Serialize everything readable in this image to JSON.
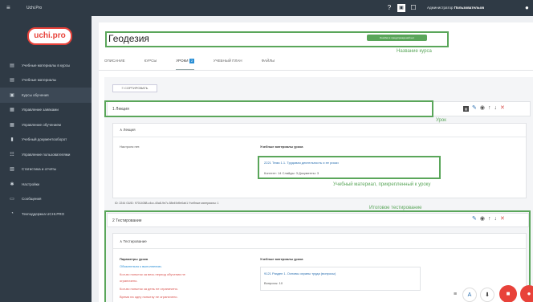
{
  "topbar": {
    "menu_icon": "≡",
    "brand": "Uchi.Pro",
    "help_icon": "?",
    "note_icon": "▣",
    "chat_icon": "☐",
    "user_prefix": "Администратор",
    "user_name": "Пользовательов",
    "user_icon": "●"
  },
  "sidebar": {
    "logo": "uchi.pro",
    "items": [
      {
        "icon": "▤",
        "label": "Учебные материалы в курсы"
      },
      {
        "icon": "▤",
        "label": "Учебные материалы"
      },
      {
        "icon": "▣",
        "label": "Курсы обучения"
      },
      {
        "icon": "▦",
        "label": "Управление заявками"
      },
      {
        "icon": "▦",
        "label": "Управление обучением"
      },
      {
        "icon": "▮",
        "label": "Учебный документооборот"
      },
      {
        "icon": "☷",
        "label": "Управление пользователями"
      },
      {
        "icon": "▧",
        "label": "Статистика и отчёты"
      },
      {
        "icon": "✱",
        "label": "Настройки"
      },
      {
        "icon": "▭",
        "label": "Сообщения"
      },
      {
        "icon": "◔",
        "label": "Техподдержка UCHI.PRO"
      }
    ]
  },
  "course": {
    "title": "Геодезия",
    "published_badge": "Ошибки в предупреждений нет",
    "course_name_note": "Название курса"
  },
  "tabs": [
    {
      "label": "ОПИСАНИЕ"
    },
    {
      "label": "КУРСЫ"
    },
    {
      "label": "УРОКИ",
      "count": "2"
    },
    {
      "label": "УЧЕБНЫЙ ПЛАН"
    },
    {
      "label": "ФАЙЛЫ"
    }
  ],
  "sort_button": "СОРТИРОВАТЬ",
  "lesson1": {
    "number": "1",
    "title": "Лекция",
    "note": "Урок",
    "sub_title": "Лекция",
    "settings": "Настроек нет.",
    "materials_heading": "Учебные материалы урока",
    "material_id": "2221",
    "material_title": "Тема 1.1. Трудовая деятельность и ее риски",
    "material_stats": "Контент: 14   Слайды: 3   Документы: 3",
    "material_note": "Учебный материал, прикрепленный к уроку",
    "footer": "ID: 2244   GUID: 97014088-c4cc-40a8-9e7c-58e49d9e0ab1   Учебные материалы: 1"
  },
  "lesson2": {
    "number": "2",
    "title": "Тестирование",
    "note": "Итоговое тестирование",
    "sub_title": "Тестирование",
    "params_heading": "Параметры урока",
    "param1": "Обязательно к выполнению.",
    "param2a": "Кол-во попыток за весь период обучения не",
    "param2b": "ограничено.",
    "param3": "Кол-во попыток за день не ограничено.",
    "param4": "Время на одну попытку не ограничено.",
    "materials_heading": "Учебные материалы урока",
    "material_id": "9121",
    "material_title": "Раздел 1. Основы охраны труда (вопросы)",
    "material_stats": "Вопросы: 10"
  },
  "actions": {
    "copy": "▤",
    "edit": "✎",
    "view": "◉",
    "up": "↑",
    "down": "↓",
    "delete": "✕"
  },
  "fabs": {
    "menu": "≡",
    "font": "A",
    "download": "⬇",
    "stop": "■",
    "close": "●"
  },
  "colors": {
    "sidebar_bg": "#2f3a45",
    "accent_green": "#5aa65a",
    "brand_red": "#e8423a",
    "link_blue": "#2a6fb0"
  }
}
